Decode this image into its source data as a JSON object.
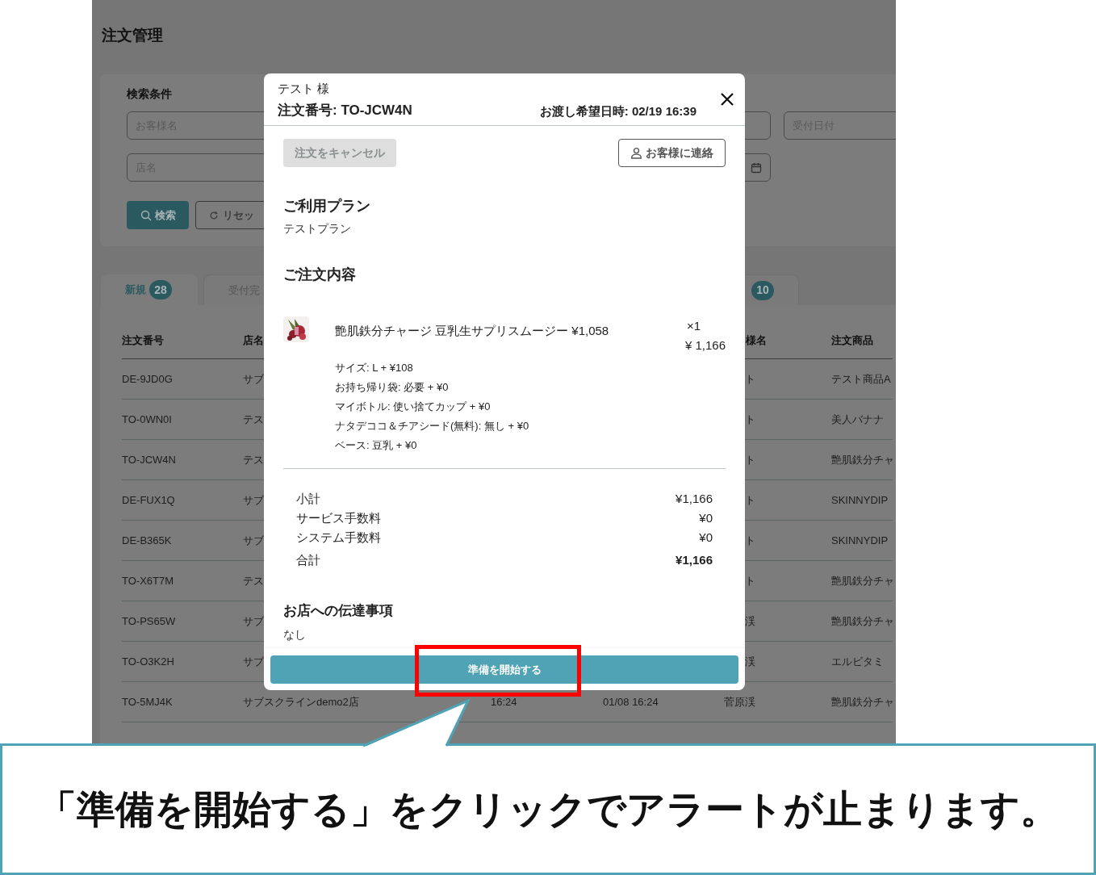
{
  "page": {
    "title": "注文管理"
  },
  "search": {
    "heading": "検索条件",
    "fields": [
      {
        "kind": "text",
        "placeholder": "お客様名"
      },
      {
        "kind": "text"
      },
      {
        "kind": "text",
        "placeholder": "受付日付"
      },
      {
        "kind": "text",
        "placeholder": "店名"
      },
      {
        "kind": "date"
      }
    ],
    "buttons": [
      {
        "kind": "primary",
        "label": "検索"
      },
      {
        "kind": "outline",
        "label": "リセッ"
      }
    ]
  },
  "tabs": [
    {
      "label": "新規",
      "count": "28",
      "selected": true
    },
    {
      "label": "受付完",
      "selected": false
    },
    {
      "count": "10",
      "selected": false
    }
  ],
  "table": {
    "columns": [
      "注文番号",
      "店名",
      "",
      "",
      "様名",
      "注文商品"
    ],
    "rows": [
      {
        "order_no": "DE-9JD0G",
        "shop": "サブ",
        "customer": "ト",
        "product": "テスト商品A"
      },
      {
        "order_no": "TO-0WN0I",
        "shop": "テス",
        "customer": "ト",
        "product": "美人バナナ"
      },
      {
        "order_no": "TO-JCW4N",
        "shop": "テス",
        "customer": "ト",
        "product": "艶肌鉄分チャ"
      },
      {
        "order_no": "DE-FUX1Q",
        "shop": "サブ",
        "customer": "ト",
        "product": "SKINNYDIP"
      },
      {
        "order_no": "DE-B365K",
        "shop": "サブ",
        "customer": "ト",
        "product": "SKINNYDIP"
      },
      {
        "order_no": "TO-X6T7M",
        "shop": "テス",
        "customer": "ト",
        "product": "艶肌鉄分チャ"
      },
      {
        "order_no": "TO-PS65W",
        "shop": "サブ",
        "customer": "渓",
        "product": "艶肌鉄分チャ"
      },
      {
        "order_no": "TO-O3K2H",
        "shop": "サブ",
        "customer": "渓",
        "product": "エルビタミ"
      },
      {
        "order_no": "TO-5MJ4K",
        "shop": "サブスクラインdemo2店",
        "time_1": "16:24",
        "time_2": "01/08 16:24",
        "customer": "菅原渓",
        "product": "艶肌鉄分チャ"
      }
    ]
  },
  "order_modal": {
    "customer": "テスト 様",
    "order_number": "注文番号: TO-JCW4N",
    "pickup_time": "お渡し希望日時: 02/19 16:39",
    "cancel_button": {
      "label": "注文をキャンセル",
      "disabled": true
    },
    "contact_button": "お客様に連絡",
    "plan": {
      "heading": "ご利用プラン",
      "text": "テストプラン"
    },
    "contents": {
      "heading": "ご注文内容",
      "item": {
        "name": "艶肌鉄分チャージ 豆乳生サプリスムージー ¥1,058",
        "quantity": "×1",
        "price": "¥ 1,166",
        "options": [
          "サイズ: L + ¥108",
          "お持ち帰り袋: 必要 + ¥0",
          "マイボトル: 使い捨てカップ + ¥0",
          "ナタデココ＆チアシード(無料): 無し + ¥0",
          "ベース: 豆乳 + ¥0"
        ]
      }
    },
    "totals": [
      {
        "label": "小計",
        "value": "¥1,166",
        "emphasized": false
      },
      {
        "label": "サービス手数料",
        "value": "¥0",
        "emphasized": false
      },
      {
        "label": "システム手数料",
        "value": "¥0",
        "emphasized": false
      },
      {
        "label": "合計",
        "value": "¥1,166",
        "emphasized": true
      }
    ],
    "notes": {
      "heading": "お店への伝達事項",
      "text": "なし"
    },
    "primary_button": "準備を開始する"
  },
  "annotation": {
    "callout_text": "「準備を開始する」をクリックでアラートが止まります。"
  }
}
